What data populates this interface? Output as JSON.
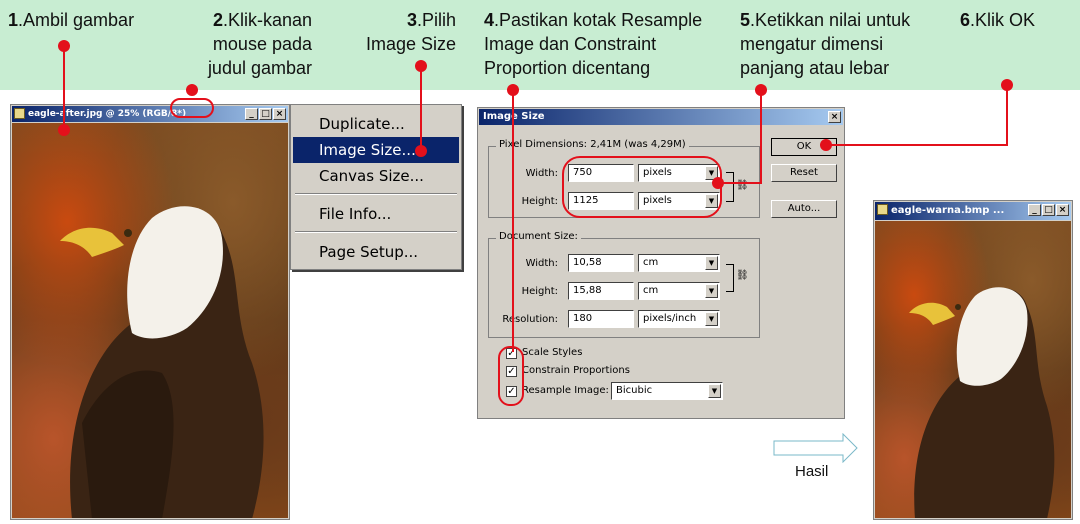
{
  "steps": [
    {
      "num": "1",
      "text": ".Ambil gambar"
    },
    {
      "num": "2",
      "text": ".Klik-kanan\nmouse pada\njudul gambar"
    },
    {
      "num": "3",
      "text": ".Pilih\nImage Size"
    },
    {
      "num": "4",
      "text": ".Pastikan kotak Resample\nImage dan Constraint\nProportion dicentang"
    },
    {
      "num": "5",
      "text": ".Ketikkan nilai untuk\nmengatur dimensi\npanjang atau lebar"
    },
    {
      "num": "6",
      "text": ".Klik OK"
    }
  ],
  "source_window": {
    "title": "eagle-after.jpg @ 25% (RGB/8*)"
  },
  "result_window": {
    "title": "eagle-warna.bmp ..."
  },
  "window_controls": {
    "minimize": "_",
    "maximize": "□",
    "close": "×"
  },
  "context_menu": {
    "items": [
      "Duplicate...",
      "Image Size...",
      "Canvas Size...",
      "File Info...",
      "Page Setup..."
    ],
    "selected": "Image Size..."
  },
  "dialog": {
    "title": "Image Size",
    "close": "×",
    "pixel_dimensions_label": "Pixel Dimensions:  2,41M (was 4,29M)",
    "width_label": "Width:",
    "height_label": "Height:",
    "pixel_width": "750",
    "pixel_height": "1125",
    "pixel_unit": "pixels",
    "document_size_label": "Document Size:",
    "doc_width": "10,58",
    "doc_height": "15,88",
    "doc_unit": "cm",
    "resolution_label": "Resolution:",
    "resolution": "180",
    "resolution_unit": "pixels/inch",
    "buttons": {
      "ok": "OK",
      "reset": "Reset",
      "auto": "Auto..."
    },
    "scale_styles": "Scale Styles",
    "constrain": "Constrain Proportions",
    "resample": "Resample Image:",
    "resample_method": "Bicubic",
    "checked": [
      true,
      true,
      true
    ]
  },
  "result_label": "Hasil",
  "colors": {
    "banner": "#c8edd2",
    "annotation": "#e3101b",
    "titlebar": "#0a246a"
  }
}
